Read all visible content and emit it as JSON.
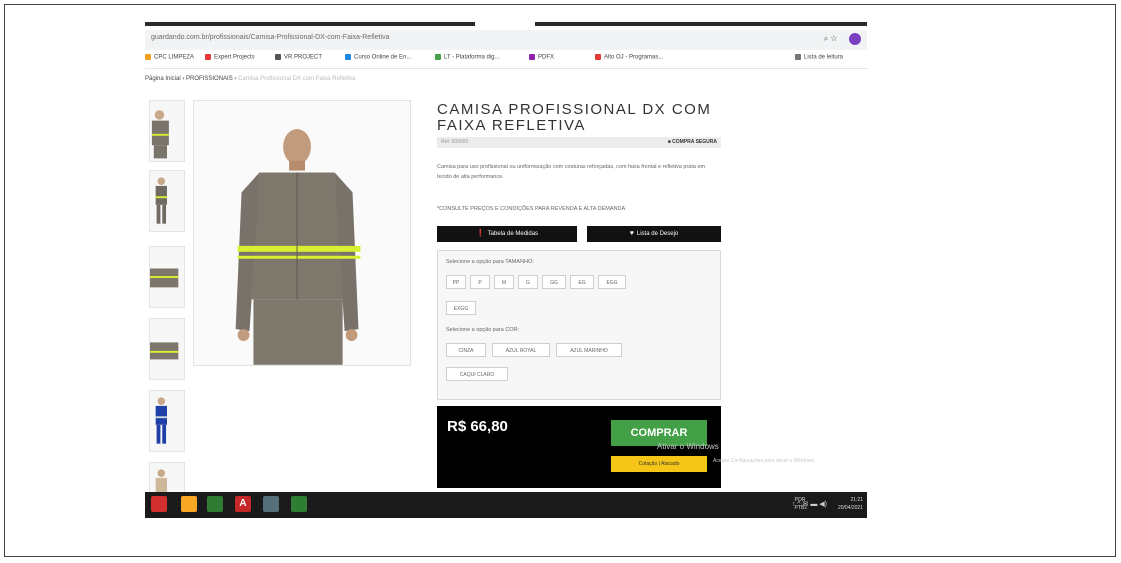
{
  "browser": {
    "url": "guardando.com.br/profissionais/Camisa-Profissional-DX-com-Faixa-Refletiva",
    "url_right_icons": "⌕  ☆",
    "bookmarks": [
      {
        "label": "CPC LIMPEZA",
        "color": "#f0a020"
      },
      {
        "label": "Expert Projects",
        "color": "#e53935"
      },
      {
        "label": "VR PROJECT",
        "color": "#555555"
      },
      {
        "label": "Curso Online de En...",
        "color": "#1e88e5"
      },
      {
        "label": "LT - Plataforma dig...",
        "color": "#43a047"
      },
      {
        "label": "PDFX",
        "color": "#8e24aa"
      },
      {
        "label": "Alto OJ - Programas...",
        "color": "#e53935"
      },
      {
        "label": "Lista de leitura",
        "color": "#777777"
      }
    ]
  },
  "breadcrumb": {
    "home": "Página Inicial",
    "sep": "›",
    "category": "PROFISSIONAIS",
    "current": "Camisa Profissional DX com Faixa Refletiva"
  },
  "product": {
    "title": "CAMISA PROFISSIONAL DX COM FAIXA REFLETIVA",
    "ref": "Ref: 000000",
    "secure_buy": "COMPRA SEGURA",
    "description": "Camisa para uso profissional ou uniformização com costuras reforçadas, com faixa frontal e refletiva prata em tecido de alta performance.",
    "notice": "*CONSULTE PREÇOS E CONDIÇÕES PARA REVENDA E ALTA DEMANDA",
    "size_table_label": "Tabela de Medidas",
    "wishlist_label": "Lista de Desejo",
    "size_prompt": "Selecione a opção para TAMANHO:",
    "sizes": [
      "PP",
      "P",
      "M",
      "G",
      "GG",
      "EG",
      "EGG",
      "EXGG"
    ],
    "color_prompt": "Selecione a opção para COR:",
    "colors": [
      "CINZA",
      "AZUL ROYAL",
      "AZUL MARINHO",
      "CAQUI CLARO"
    ],
    "price": "R$ 66,80",
    "buy_label": "COMPRAR",
    "quote_label": "Cotação | Atacado",
    "accent_green": "#43a047",
    "accent_yellow": "#f5c518"
  },
  "watermark": {
    "line1": "Ativar o Windows",
    "line2": "Acesse Configurações para ativar o Windows."
  },
  "taskbar": {
    "apps": [
      {
        "icon": "pdf-icon",
        "color": "#d32f2f",
        "glyph": ""
      },
      {
        "icon": "folder-icon",
        "color": "#f9a825",
        "glyph": ""
      },
      {
        "icon": "chrome-icon",
        "color": "#2e7d32",
        "glyph": ""
      },
      {
        "icon": "autocad-icon",
        "color": "#c62828",
        "glyph": "A"
      },
      {
        "icon": "people-icon",
        "color": "#546e7a",
        "glyph": ""
      },
      {
        "icon": "excel-icon",
        "color": "#2e7d32",
        "glyph": ""
      }
    ],
    "tray": "↑  ^  ✉  ▬  ◀)",
    "lang": "POR\nPTB2",
    "time": "21:21",
    "date": "20/04/2021"
  }
}
